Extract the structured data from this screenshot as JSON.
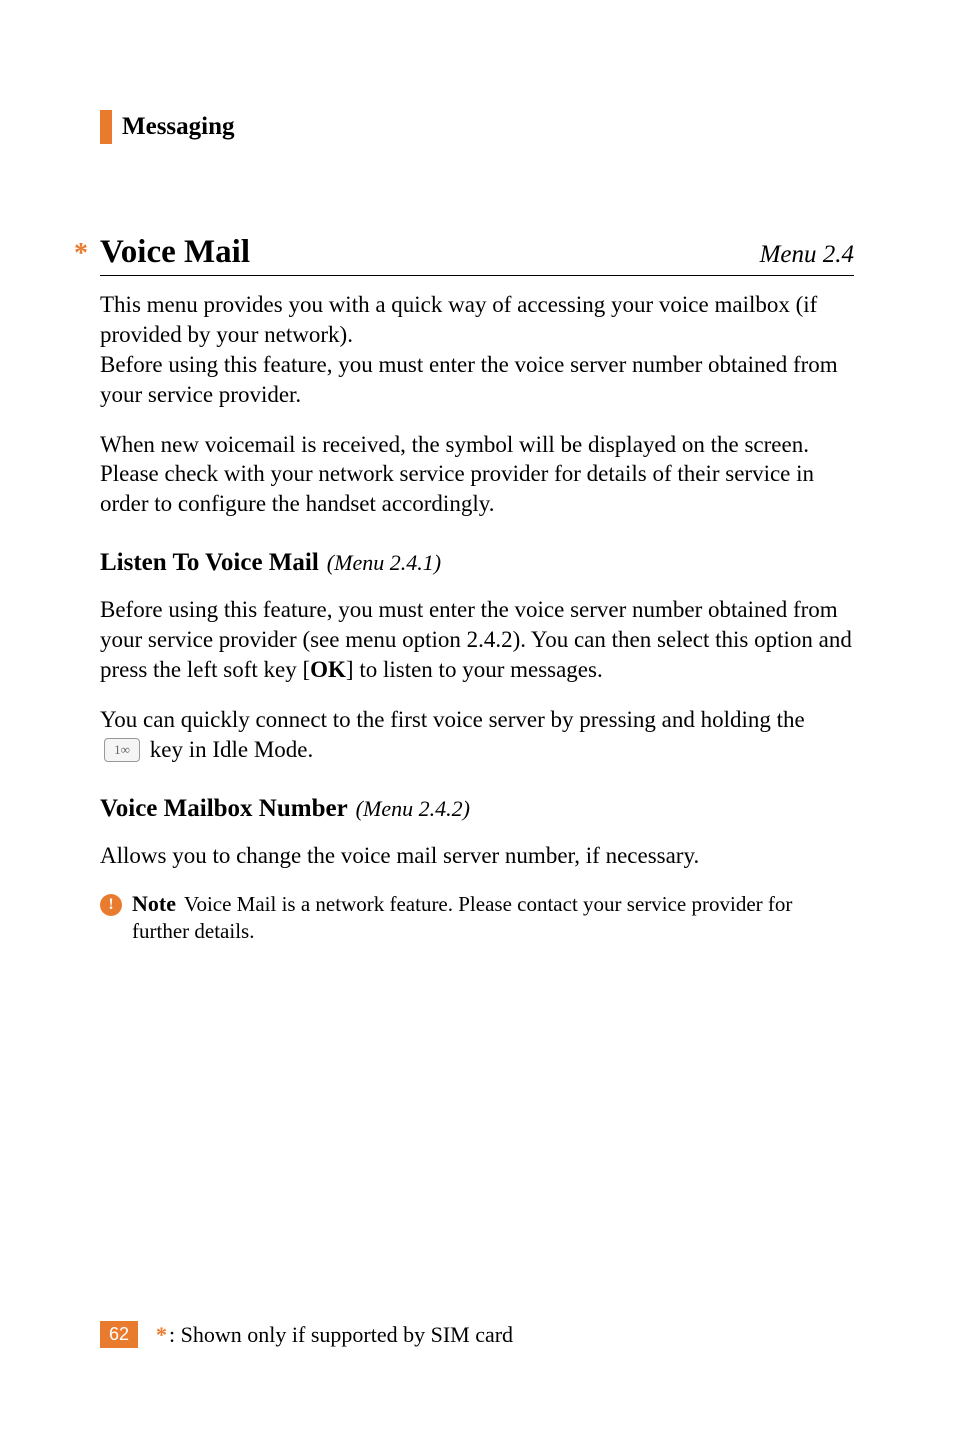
{
  "header": {
    "section_title": "Messaging"
  },
  "voice_mail": {
    "asterisk": "*",
    "heading": "Voice Mail",
    "menu_ref": "Menu 2.4",
    "para1": "This menu provides you with a quick way of accessing your voice mailbox (if provided by your network).",
    "para2": "Before using this feature, you must enter the voice server number obtained from your service provider.",
    "para3": "When new voicemail is received, the symbol will be displayed on the screen. Please check with your network service provider for details of their service in order to configure the handset accordingly."
  },
  "listen": {
    "heading": "Listen To Voice Mail",
    "menu_ref": "(Menu 2.4.1)",
    "para1_a": "Before using this feature, you must enter the voice server number obtained from your service provider (see menu option 2.4.2). You can then select this option and press the left soft key [",
    "ok": "OK",
    "para1_b": "] to listen to your messages.",
    "para2_a": "You can quickly connect to the first voice server by pressing and holding the ",
    "key_label": "1∞",
    "para2_b": " key in Idle Mode."
  },
  "mailbox": {
    "heading": "Voice Mailbox Number",
    "menu_ref": "(Menu 2.4.2)",
    "para1": "Allows you to change the voice mail server number, if necessary."
  },
  "note": {
    "icon": "!",
    "label": "Note",
    "text": "Voice Mail is a network feature. Please contact your service provider for further details."
  },
  "footer": {
    "page": "62",
    "asterisk": "*",
    "text": ": Shown only if supported by SIM card"
  }
}
